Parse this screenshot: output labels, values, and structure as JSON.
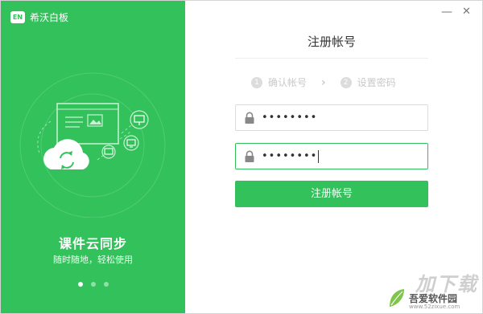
{
  "brand": {
    "logo_text": "EN",
    "app_name": "希沃白板"
  },
  "window_controls": {
    "minimize_glyph": "—",
    "close_glyph": "✕"
  },
  "left_panel": {
    "slogan_title": "课件云同步",
    "slogan_subtitle": "随时随地，轻松使用",
    "carousel": {
      "count": 3,
      "active_index": 0
    }
  },
  "form": {
    "title": "注册帐号",
    "steps": [
      {
        "num": "1",
        "label": "确认帐号"
      },
      {
        "num": "2",
        "label": "设置密码"
      }
    ],
    "step_arrow": "›",
    "password_value": "••••••••",
    "confirm_value": "••••••••",
    "submit_label": "注册帐号"
  },
  "watermark": {
    "big_text": "加下载",
    "site_name": "吾爱软件园",
    "site_url": "www.52zixue.com"
  },
  "colors": {
    "brand_green": "#33c15b",
    "dot_inactive": "#8fe0a6"
  }
}
